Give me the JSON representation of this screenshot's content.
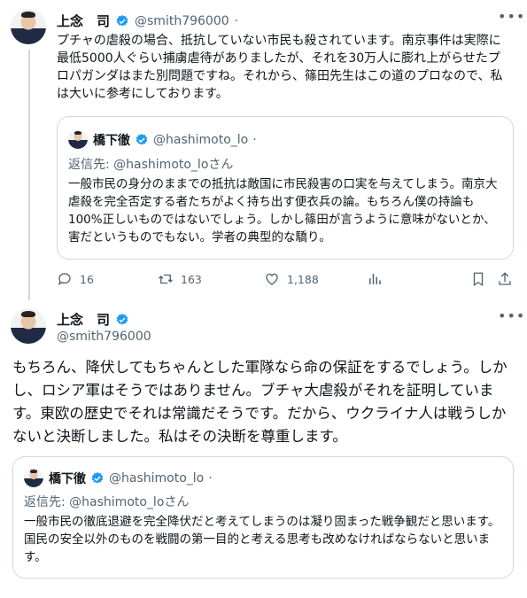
{
  "tweet1": {
    "name": "上念　司",
    "handle": "@smith796000",
    "sep": "·",
    "text": "プチャの虐殺の場合、抵抗していない市民も殺されています。南京事件は実際に最低5000人ぐらい捕虜虐待がありましたが、それを30万人に膨れ上がらせたプロパガンダはまた別問題ですね。それから、篠田先生はこの道のプロなので、私は大いに参考にしております。",
    "quote": {
      "name": "橋下徹",
      "handle": "@hashimoto_lo",
      "sep": "·",
      "reply_to": "返信先: @hashimoto_loさん",
      "text": "一般市民の身分のままでの抵抗は敵国に市民殺害の口実を与えてしまう。南京大虐殺を完全否定する者たちがよく持ち出す便衣兵の論。もちろん僕の持論も100%正しいものではないでしょう。しかし篠田が言うように意味がないとか、害だというものでもない。学者の典型的な驕り。"
    },
    "actions": {
      "replies": "16",
      "retweets": "163",
      "likes": "1,188"
    }
  },
  "tweet2": {
    "name": "上念　司",
    "handle": "@smith796000",
    "text": "もちろん、降伏してもちゃんとした軍隊なら命の保証をするでしょう。しかし、ロシア軍はそうではありません。ブチャ大虐殺がそれを証明しています。東欧の歴史でそれは常識だそうです。だから、ウクライナ人は戦うしかないと決断しました。私はその決断を尊重します。",
    "quote": {
      "name": "橋下徹",
      "handle": "@hashimoto_lo",
      "sep": "·",
      "reply_to": "返信先: @hashimoto_loさん",
      "text": "一般市民の徹底退避を完全降伏だと考えてしまうのは凝り固まった戦争観だと思います。国民の安全以外のものを戦闘の第一目的と考える思考も改めなければならないと思います。"
    }
  },
  "icons": {
    "more": "more-dots-icon",
    "verified": "verified-badge-icon",
    "reply": "reply-icon",
    "retweet": "retweet-icon",
    "like": "heart-icon",
    "views": "views-bar-icon",
    "bookmark": "bookmark-icon",
    "share": "share-icon"
  },
  "colors": {
    "verified": "#1d9bf0",
    "text": "#0f1419",
    "muted": "#536471",
    "border": "#cfd9de"
  }
}
